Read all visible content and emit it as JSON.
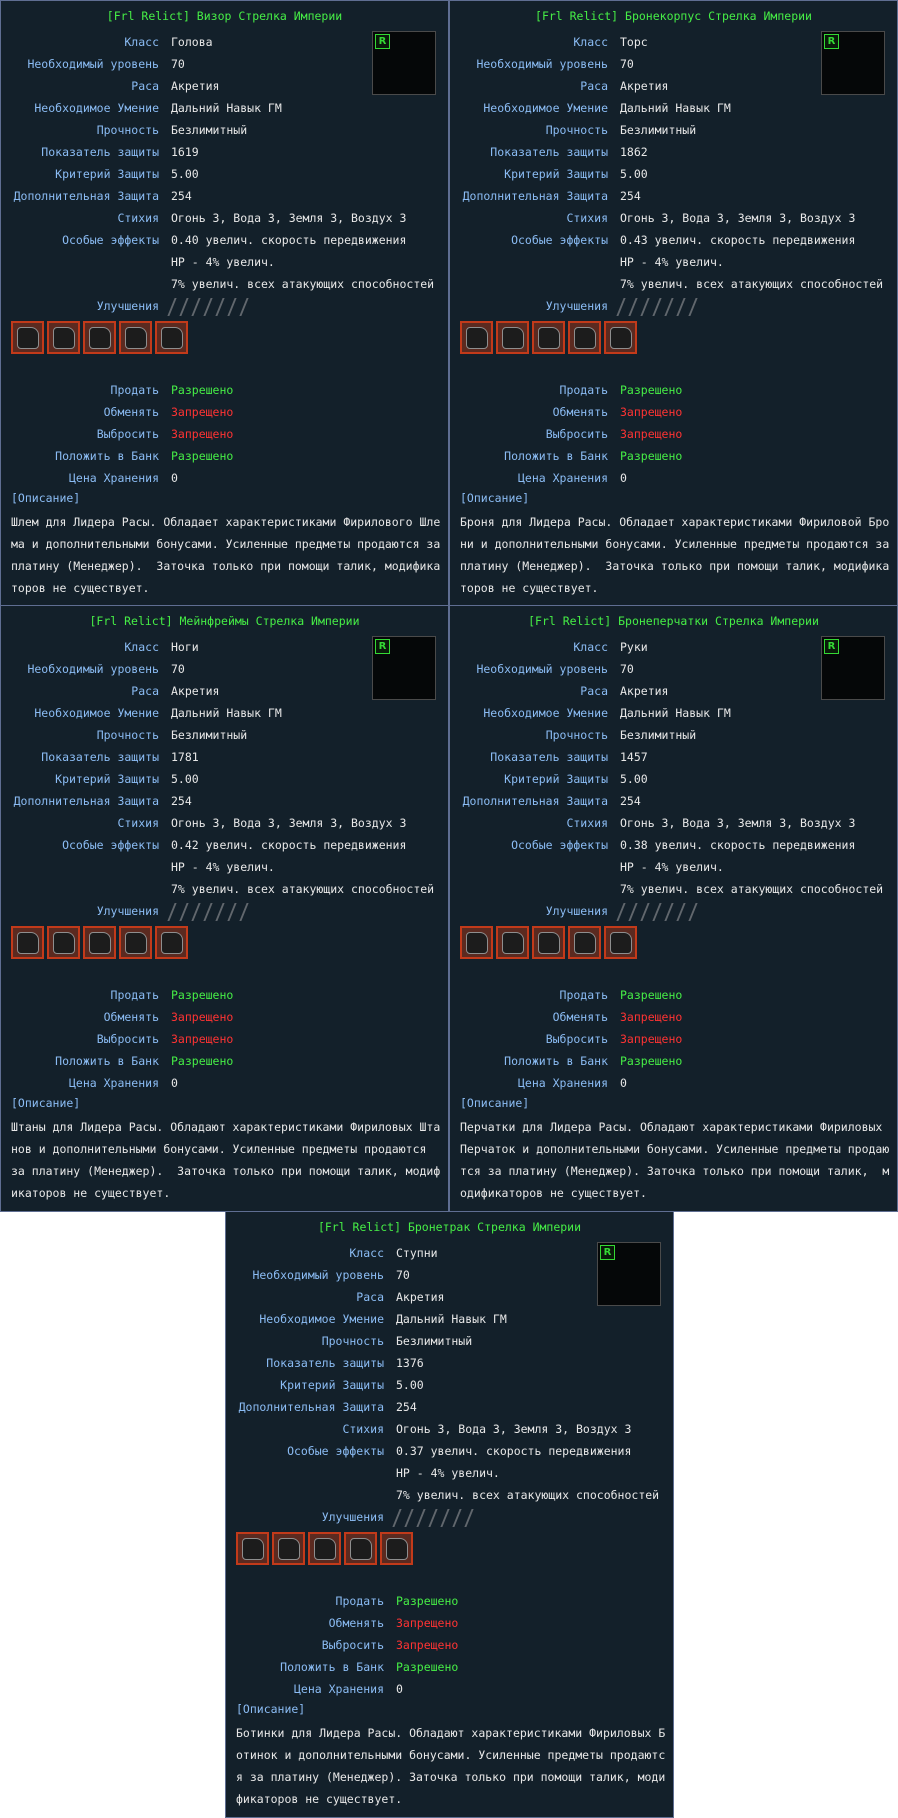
{
  "labels": {
    "class": "Класс",
    "level": "Необходимый уровень",
    "race": "Раса",
    "skill": "Необходимое Умение",
    "durability": "Прочность",
    "defense": "Показатель защиты",
    "crit": "Критерий Защиты",
    "extra": "Дополнительная Защита",
    "element": "Стихия",
    "effects": "Особые эффекты",
    "upgrades": "Улучшения",
    "sell": "Продать",
    "trade": "Обменять",
    "drop": "Выбросить",
    "bank": "Положить в Банк",
    "storage": "Цена Хранения",
    "description": "[Описание]"
  },
  "rank_badge": "R",
  "upgrade_slots": 7,
  "items": [
    {
      "title": "[Frl Relict] Визор Стрелка Империи",
      "class": "Голова",
      "level": "70",
      "race": "Акретия",
      "skill": "Дальний Навык ГМ",
      "durability": "Безлимитный",
      "defense": "1619",
      "crit": "5.00",
      "extra": "254",
      "element": "Огонь 3, Вода 3, Земля 3, Воздух 3",
      "effect1": "0.40 увелич. скорость передвижения",
      "effect2": "HP - 4% увелич.",
      "effect3": "7% увелич. всех атакующих способностей",
      "sell": "Разрешено",
      "trade": "Запрещено",
      "drop": "Запрещено",
      "bank": "Разрешено",
      "storage": "0",
      "desc": "Шлем для Лидера Расы. Обладает характеристиками Фирилового Шлема и дополнительными бонусами. Усиленные предметы продаются за платину (Менеджер).  Заточка только при помощи талик, модификаторов не существует."
    },
    {
      "title": "[Frl Relict] Бронекорпус Стрелка Империи",
      "class": "Торс",
      "level": "70",
      "race": "Акретия",
      "skill": "Дальний Навык ГМ",
      "durability": "Безлимитный",
      "defense": "1862",
      "crit": "5.00",
      "extra": "254",
      "element": "Огонь 3, Вода 3, Земля 3, Воздух 3",
      "effect1": "0.43 увелич. скорость передвижения",
      "effect2": "HP - 4% увелич.",
      "effect3": "7% увелич. всех атакующих способностей",
      "sell": "Разрешено",
      "trade": "Запрещено",
      "drop": "Запрещено",
      "bank": "Разрешено",
      "storage": "0",
      "desc": "Броня для Лидера Расы. Обладает характеристиками Фириловой Брони и дополнительными бонусами. Усиленные предметы продаются за платину (Менеджер).  Заточка только при помощи талик, модификаторов не существует."
    },
    {
      "title": "[Frl Relict] Мейнфреймы Стрелка Империи",
      "class": "Ноги",
      "level": "70",
      "race": "Акретия",
      "skill": "Дальний Навык ГМ",
      "durability": "Безлимитный",
      "defense": "1781",
      "crit": "5.00",
      "extra": "254",
      "element": "Огонь 3, Вода 3, Земля 3, Воздух 3",
      "effect1": "0.42 увелич. скорость передвижения",
      "effect2": "HP - 4% увелич.",
      "effect3": "7% увелич. всех атакующих способностей",
      "sell": "Разрешено",
      "trade": "Запрещено",
      "drop": "Запрещено",
      "bank": "Разрешено",
      "storage": "0",
      "desc": "Штаны для Лидера Расы. Обладают характеристиками Фириловых Штанов и дополнительными бонусами. Усиленные предметы продаются  за платину (Менеджер).  Заточка только при помощи талик, модификаторов не существует."
    },
    {
      "title": "[Frl Relict] Бронеперчатки Стрелка Империи",
      "class": "Руки",
      "level": "70",
      "race": "Акретия",
      "skill": "Дальний Навык ГМ",
      "durability": "Безлимитный",
      "defense": "1457",
      "crit": "5.00",
      "extra": "254",
      "element": "Огонь 3, Вода 3, Земля 3, Воздух 3",
      "effect1": "0.38 увелич. скорость передвижения",
      "effect2": "HP - 4% увелич.",
      "effect3": "7% увелич. всех атакующих способностей",
      "sell": "Разрешено",
      "trade": "Запрещено",
      "drop": "Запрещено",
      "bank": "Разрешено",
      "storage": "0",
      "desc": "Перчатки для Лидера Расы. Обладают характеристиками Фириловых  Перчаток и дополнительными бонусами. Усиленные предметы продаются за платину (Менеджер). Заточка только при помощи талик,  модификаторов не существует."
    },
    {
      "title": "[Frl Relict] Бронетрак Стрелка Империи",
      "class": "Ступни",
      "level": "70",
      "race": "Акретия",
      "skill": "Дальний Навык ГМ",
      "durability": "Безлимитный",
      "defense": "1376",
      "crit": "5.00",
      "extra": "254",
      "element": "Огонь 3, Вода 3, Земля 3, Воздух 3",
      "effect1": "0.37 увелич. скорость передвижения",
      "effect2": "HP - 4% увелич.",
      "effect3": "7% увелич. всех атакующих способностей",
      "sell": "Разрешено",
      "trade": "Запрещено",
      "drop": "Запрещено",
      "bank": "Разрешено",
      "storage": "0",
      "desc": "Ботинки для Лидера Расы. Обладают характеристиками Фириловых Ботинок и дополнительными бонусами. Усиленные предметы продаются за платину (Менеджер). Заточка только при помощи талик, модификаторов не существует."
    }
  ]
}
